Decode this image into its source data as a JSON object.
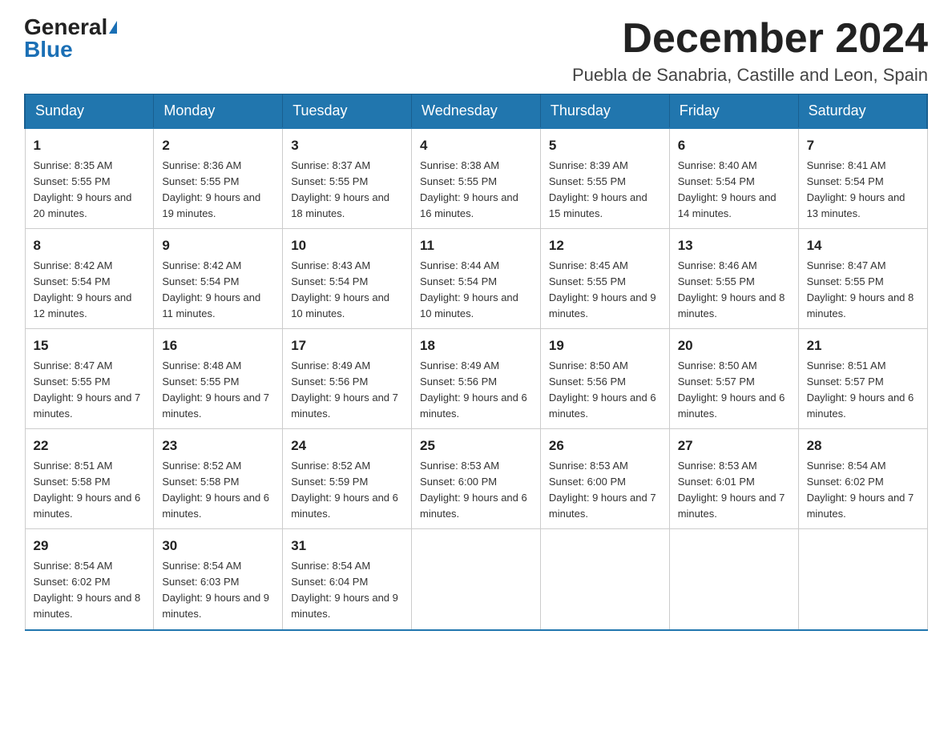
{
  "header": {
    "logo_general": "General",
    "logo_blue": "Blue",
    "month_title": "December 2024",
    "location": "Puebla de Sanabria, Castille and Leon, Spain"
  },
  "days_of_week": [
    "Sunday",
    "Monday",
    "Tuesday",
    "Wednesday",
    "Thursday",
    "Friday",
    "Saturday"
  ],
  "weeks": [
    [
      {
        "day": "1",
        "sunrise": "8:35 AM",
        "sunset": "5:55 PM",
        "daylight": "9 hours and 20 minutes."
      },
      {
        "day": "2",
        "sunrise": "8:36 AM",
        "sunset": "5:55 PM",
        "daylight": "9 hours and 19 minutes."
      },
      {
        "day": "3",
        "sunrise": "8:37 AM",
        "sunset": "5:55 PM",
        "daylight": "9 hours and 18 minutes."
      },
      {
        "day": "4",
        "sunrise": "8:38 AM",
        "sunset": "5:55 PM",
        "daylight": "9 hours and 16 minutes."
      },
      {
        "day": "5",
        "sunrise": "8:39 AM",
        "sunset": "5:55 PM",
        "daylight": "9 hours and 15 minutes."
      },
      {
        "day": "6",
        "sunrise": "8:40 AM",
        "sunset": "5:54 PM",
        "daylight": "9 hours and 14 minutes."
      },
      {
        "day": "7",
        "sunrise": "8:41 AM",
        "sunset": "5:54 PM",
        "daylight": "9 hours and 13 minutes."
      }
    ],
    [
      {
        "day": "8",
        "sunrise": "8:42 AM",
        "sunset": "5:54 PM",
        "daylight": "9 hours and 12 minutes."
      },
      {
        "day": "9",
        "sunrise": "8:42 AM",
        "sunset": "5:54 PM",
        "daylight": "9 hours and 11 minutes."
      },
      {
        "day": "10",
        "sunrise": "8:43 AM",
        "sunset": "5:54 PM",
        "daylight": "9 hours and 10 minutes."
      },
      {
        "day": "11",
        "sunrise": "8:44 AM",
        "sunset": "5:54 PM",
        "daylight": "9 hours and 10 minutes."
      },
      {
        "day": "12",
        "sunrise": "8:45 AM",
        "sunset": "5:55 PM",
        "daylight": "9 hours and 9 minutes."
      },
      {
        "day": "13",
        "sunrise": "8:46 AM",
        "sunset": "5:55 PM",
        "daylight": "9 hours and 8 minutes."
      },
      {
        "day": "14",
        "sunrise": "8:47 AM",
        "sunset": "5:55 PM",
        "daylight": "9 hours and 8 minutes."
      }
    ],
    [
      {
        "day": "15",
        "sunrise": "8:47 AM",
        "sunset": "5:55 PM",
        "daylight": "9 hours and 7 minutes."
      },
      {
        "day": "16",
        "sunrise": "8:48 AM",
        "sunset": "5:55 PM",
        "daylight": "9 hours and 7 minutes."
      },
      {
        "day": "17",
        "sunrise": "8:49 AM",
        "sunset": "5:56 PM",
        "daylight": "9 hours and 7 minutes."
      },
      {
        "day": "18",
        "sunrise": "8:49 AM",
        "sunset": "5:56 PM",
        "daylight": "9 hours and 6 minutes."
      },
      {
        "day": "19",
        "sunrise": "8:50 AM",
        "sunset": "5:56 PM",
        "daylight": "9 hours and 6 minutes."
      },
      {
        "day": "20",
        "sunrise": "8:50 AM",
        "sunset": "5:57 PM",
        "daylight": "9 hours and 6 minutes."
      },
      {
        "day": "21",
        "sunrise": "8:51 AM",
        "sunset": "5:57 PM",
        "daylight": "9 hours and 6 minutes."
      }
    ],
    [
      {
        "day": "22",
        "sunrise": "8:51 AM",
        "sunset": "5:58 PM",
        "daylight": "9 hours and 6 minutes."
      },
      {
        "day": "23",
        "sunrise": "8:52 AM",
        "sunset": "5:58 PM",
        "daylight": "9 hours and 6 minutes."
      },
      {
        "day": "24",
        "sunrise": "8:52 AM",
        "sunset": "5:59 PM",
        "daylight": "9 hours and 6 minutes."
      },
      {
        "day": "25",
        "sunrise": "8:53 AM",
        "sunset": "6:00 PM",
        "daylight": "9 hours and 6 minutes."
      },
      {
        "day": "26",
        "sunrise": "8:53 AM",
        "sunset": "6:00 PM",
        "daylight": "9 hours and 7 minutes."
      },
      {
        "day": "27",
        "sunrise": "8:53 AM",
        "sunset": "6:01 PM",
        "daylight": "9 hours and 7 minutes."
      },
      {
        "day": "28",
        "sunrise": "8:54 AM",
        "sunset": "6:02 PM",
        "daylight": "9 hours and 7 minutes."
      }
    ],
    [
      {
        "day": "29",
        "sunrise": "8:54 AM",
        "sunset": "6:02 PM",
        "daylight": "9 hours and 8 minutes."
      },
      {
        "day": "30",
        "sunrise": "8:54 AM",
        "sunset": "6:03 PM",
        "daylight": "9 hours and 9 minutes."
      },
      {
        "day": "31",
        "sunrise": "8:54 AM",
        "sunset": "6:04 PM",
        "daylight": "9 hours and 9 minutes."
      },
      null,
      null,
      null,
      null
    ]
  ]
}
